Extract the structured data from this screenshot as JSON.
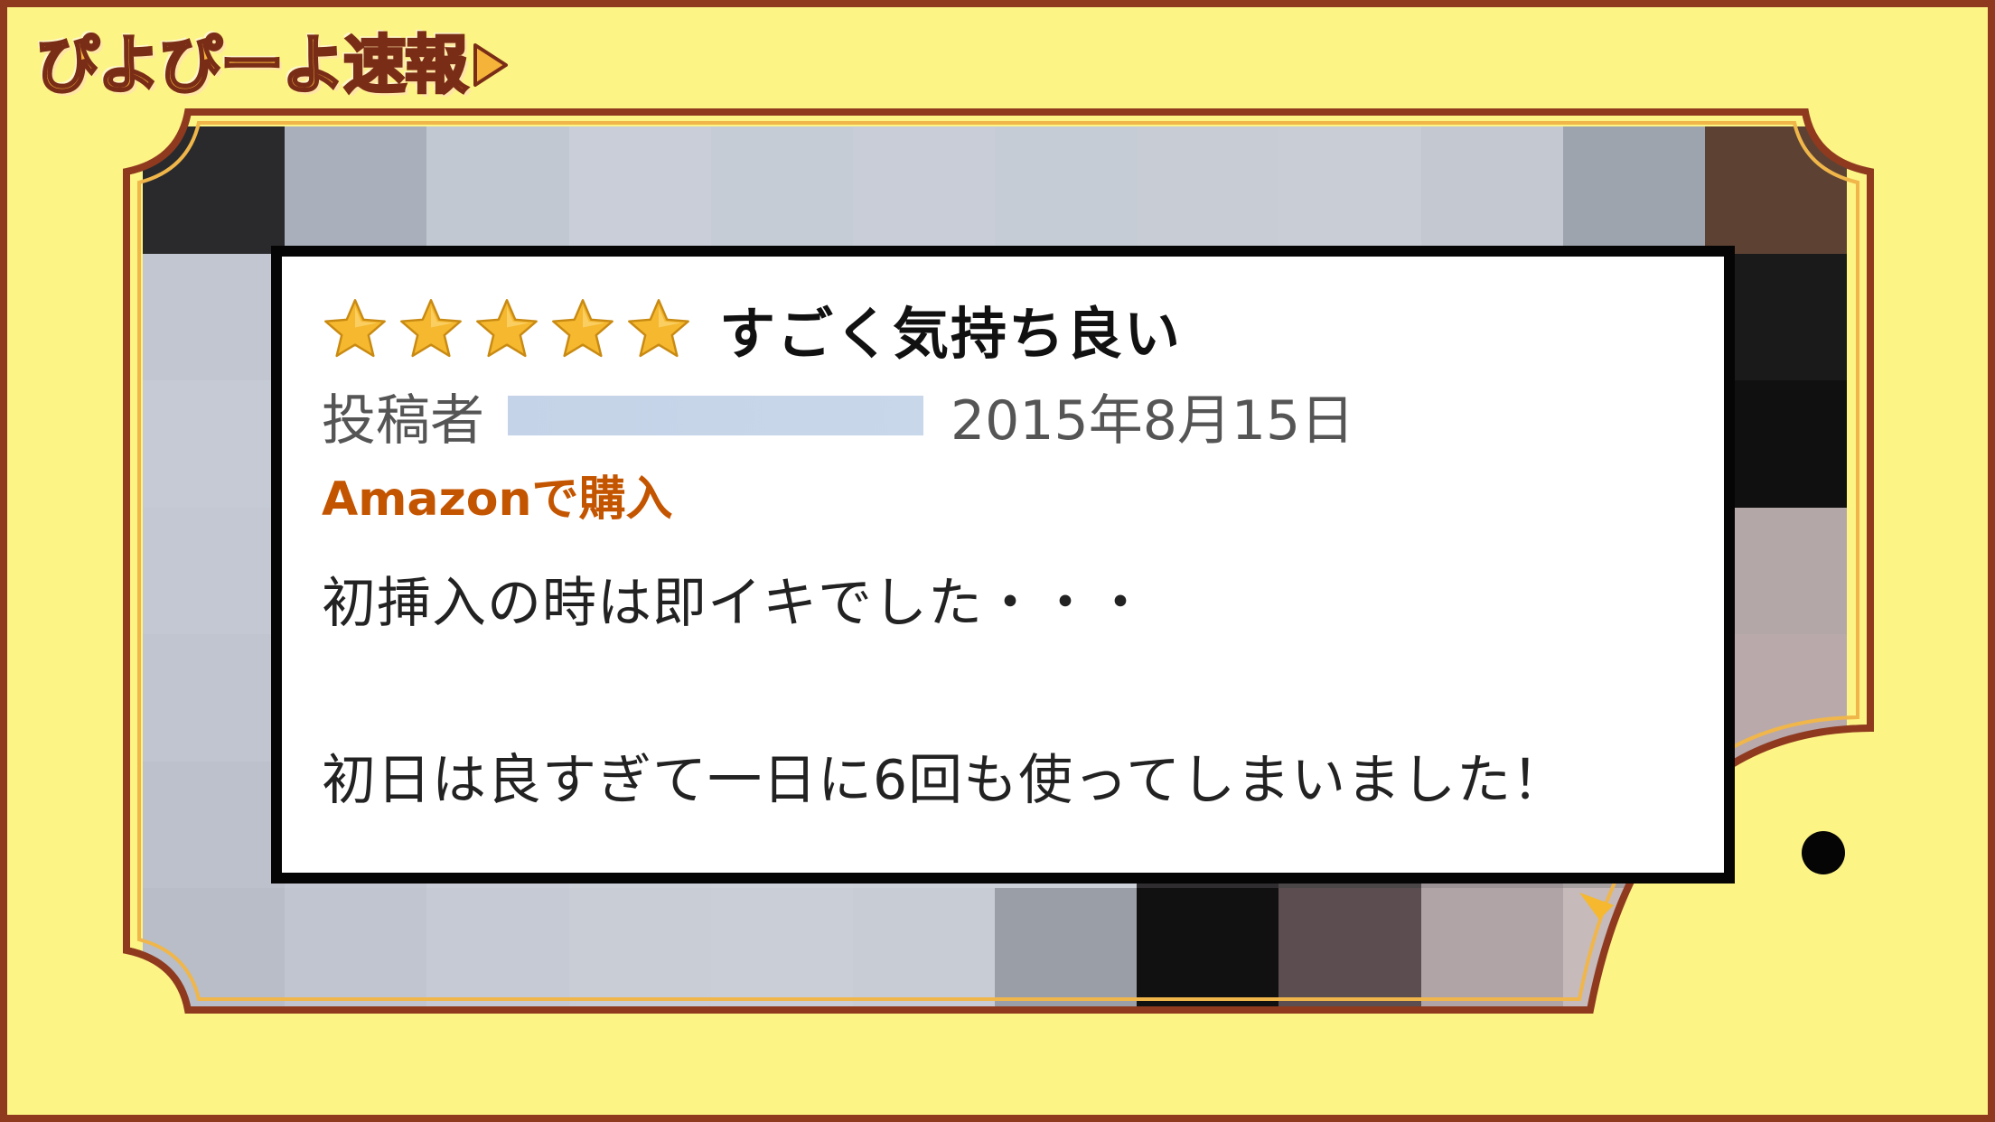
{
  "logo": {
    "text": "ぴよぴーよ速報"
  },
  "review": {
    "rating": 5,
    "rating_max": 5,
    "title": "すごく気持ち良い",
    "author_label": "投稿者",
    "date": "2015年8月15日",
    "purchase_badge": "Amazonで購入",
    "body_lines": [
      "初挿入の時は即イキでした・・・",
      "初日は良すぎて一日に6回も使ってしまいました！"
    ]
  },
  "colors": {
    "background": "#fdf486",
    "frame": "#8f3a1f",
    "star": "#f5b82e",
    "purchase": "#c45500"
  }
}
